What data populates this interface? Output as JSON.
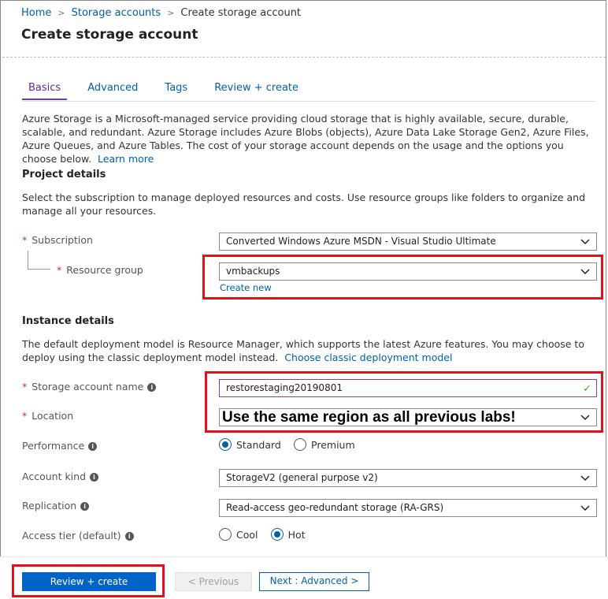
{
  "breadcrumb": {
    "items": [
      "Home",
      "Storage accounts"
    ],
    "current": "Create storage account"
  },
  "page_title": "Create storage account",
  "tabs": [
    {
      "label": "Basics",
      "active": true
    },
    {
      "label": "Advanced",
      "active": false
    },
    {
      "label": "Tags",
      "active": false
    },
    {
      "label": "Review + create",
      "active": false
    }
  ],
  "intro": {
    "text": "Azure Storage is a Microsoft-managed service providing cloud storage that is highly available, secure, durable, scalable, and redundant. Azure Storage includes Azure Blobs (objects), Azure Data Lake Storage Gen2, Azure Files, Azure Queues, and Azure Tables. The cost of your storage account depends on the usage and the options you choose below.",
    "link": "Learn more"
  },
  "project": {
    "heading": "Project details",
    "description": "Select the subscription to manage deployed resources and costs. Use resource groups like folders to organize and manage all your resources.",
    "subscription_label": "Subscription",
    "subscription_value": "Converted Windows Azure MSDN - Visual Studio Ultimate",
    "resource_group_label": "Resource group",
    "resource_group_value": "vmbackups",
    "create_new": "Create new"
  },
  "instance": {
    "heading": "Instance details",
    "description": "The default deployment model is Resource Manager, which supports the latest Azure features. You may choose to deploy using the classic deployment model instead.",
    "classic_link": "Choose classic deployment model",
    "storage_name_label": "Storage account name",
    "storage_name_value": "restorestaging20190801",
    "location_label": "Location",
    "location_overlay": "Use the same region as all previous labs!",
    "performance_label": "Performance",
    "performance_options": [
      "Standard",
      "Premium"
    ],
    "performance_selected": "Standard",
    "account_kind_label": "Account kind",
    "account_kind_value": "StorageV2 (general purpose v2)",
    "replication_label": "Replication",
    "replication_value": "Read-access geo-redundant storage (RA-GRS)",
    "access_tier_label": "Access tier (default)",
    "access_tier_options": [
      "Cool",
      "Hot"
    ],
    "access_tier_selected": "Hot"
  },
  "footer": {
    "review_create": "Review + create",
    "previous": "< Previous",
    "next": "Next : Advanced >"
  },
  "icons": {
    "info": "i",
    "check": "✓",
    "chevron": "chevron-down-icon"
  },
  "colors": {
    "accent": "#0060a8",
    "primary_button": "#0063c6",
    "active_tab": "#6f3cb9",
    "highlight_box": "#e3101e",
    "required": "#c9302c"
  }
}
